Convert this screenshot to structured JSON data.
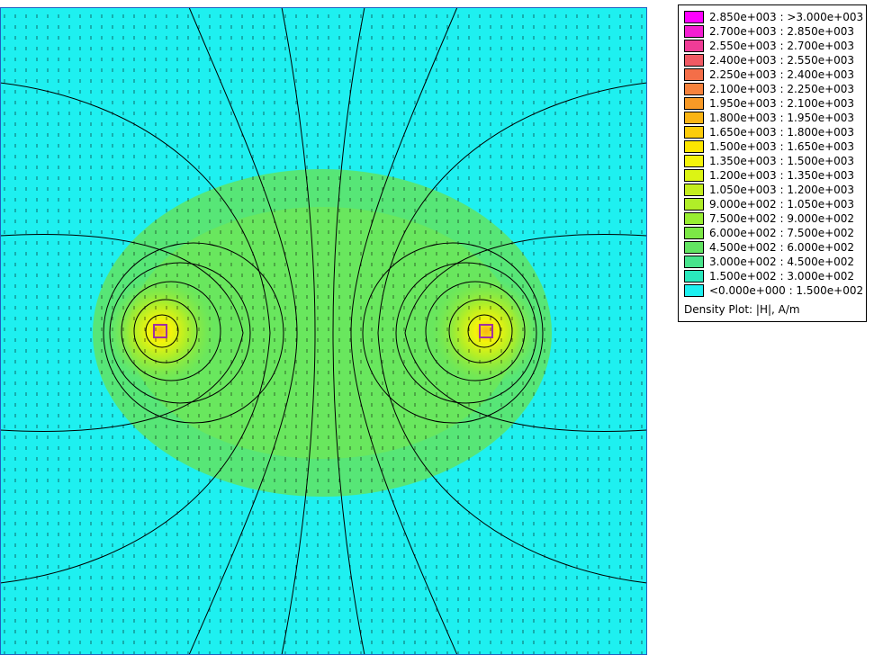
{
  "chart_data": {
    "type": "heatmap",
    "title": "Density Plot: |H|, A/m",
    "quantity": "|H|",
    "units": "A/m",
    "legend_position": "top-right",
    "bins": [
      {
        "label": "2.850e+003 : >3.000e+003",
        "min": 2850,
        "max": 3000,
        "color": "#ff00ff"
      },
      {
        "label": "2.700e+003 : 2.850e+003",
        "min": 2700,
        "max": 2850,
        "color": "#f41ed2"
      },
      {
        "label": "2.550e+003 : 2.700e+003",
        "min": 2550,
        "max": 2700,
        "color": "#f03c96"
      },
      {
        "label": "2.400e+003 : 2.550e+003",
        "min": 2400,
        "max": 2550,
        "color": "#f05a64"
      },
      {
        "label": "2.250e+003 : 2.400e+003",
        "min": 2250,
        "max": 2400,
        "color": "#f46e48"
      },
      {
        "label": "2.100e+003 : 2.250e+003",
        "min": 2100,
        "max": 2250,
        "color": "#f6823c"
      },
      {
        "label": "1.950e+003 : 2.100e+003",
        "min": 1950,
        "max": 2100,
        "color": "#f89a26"
      },
      {
        "label": "1.800e+003 : 1.950e+003",
        "min": 1800,
        "max": 1950,
        "color": "#fab414"
      },
      {
        "label": "1.650e+003 : 1.800e+003",
        "min": 1650,
        "max": 1800,
        "color": "#fccc0a"
      },
      {
        "label": "1.500e+003 : 1.650e+003",
        "min": 1500,
        "max": 1650,
        "color": "#fce600"
      },
      {
        "label": "1.350e+003 : 1.500e+003",
        "min": 1350,
        "max": 1500,
        "color": "#f4f40a"
      },
      {
        "label": "1.200e+003 : 1.350e+003",
        "min": 1200,
        "max": 1350,
        "color": "#dcf414"
      },
      {
        "label": "1.050e+003 : 1.200e+003",
        "min": 1050,
        "max": 1200,
        "color": "#c4ee1e"
      },
      {
        "label": "9.000e+002 : 1.050e+003",
        "min": 900,
        "max": 1050,
        "color": "#b0ee28"
      },
      {
        "label": "7.500e+002 : 9.000e+002",
        "min": 750,
        "max": 900,
        "color": "#98ee32"
      },
      {
        "label": "6.000e+002 : 7.500e+002",
        "min": 600,
        "max": 750,
        "color": "#7ce846"
      },
      {
        "label": "4.500e+002 : 6.000e+002",
        "min": 450,
        "max": 600,
        "color": "#62e462"
      },
      {
        "label": "3.000e+002 : 4.500e+002",
        "min": 300,
        "max": 450,
        "color": "#48e48c"
      },
      {
        "label": "1.500e+002 : 3.000e+002",
        "min": 150,
        "max": 300,
        "color": "#2ae8bc"
      },
      {
        "label": "<0.000e+000 : 1.500e+002",
        "min": 0,
        "max": 150,
        "color": "#1ef0f0"
      }
    ]
  }
}
